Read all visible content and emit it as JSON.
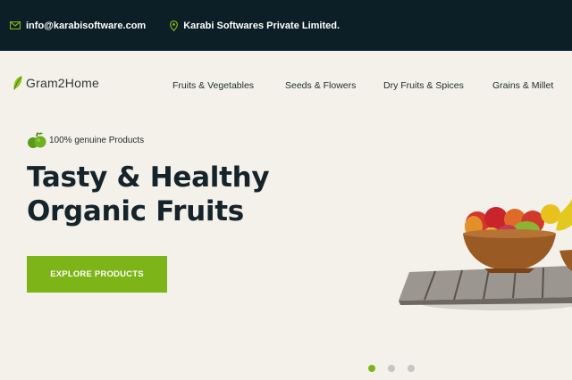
{
  "topbar": {
    "email": "info@karabisoftware.com",
    "company": "Karabi Softwares Private Limited."
  },
  "brand": {
    "name": "Gram2Home"
  },
  "nav": {
    "items": [
      {
        "label": "Fruits & Vegetables"
      },
      {
        "label": "Seeds & Flowers"
      },
      {
        "label": "Dry Fruits & Spices"
      },
      {
        "label": "Grains & Millet"
      }
    ]
  },
  "hero": {
    "tagline": "100% genuine Products",
    "title_line1": "Tasty & Healthy",
    "title_line2": "Organic Fruits",
    "cta_label": "EXPLORE PRODUCTS",
    "image_icon": "fruit-bowl-icon"
  },
  "carousel": {
    "slide_count": 3,
    "active_index": 0
  },
  "colors": {
    "topbar_bg": "#0d1f26",
    "page_bg": "#f4f1ea",
    "accent": "#7db519",
    "heading": "#14242a"
  }
}
